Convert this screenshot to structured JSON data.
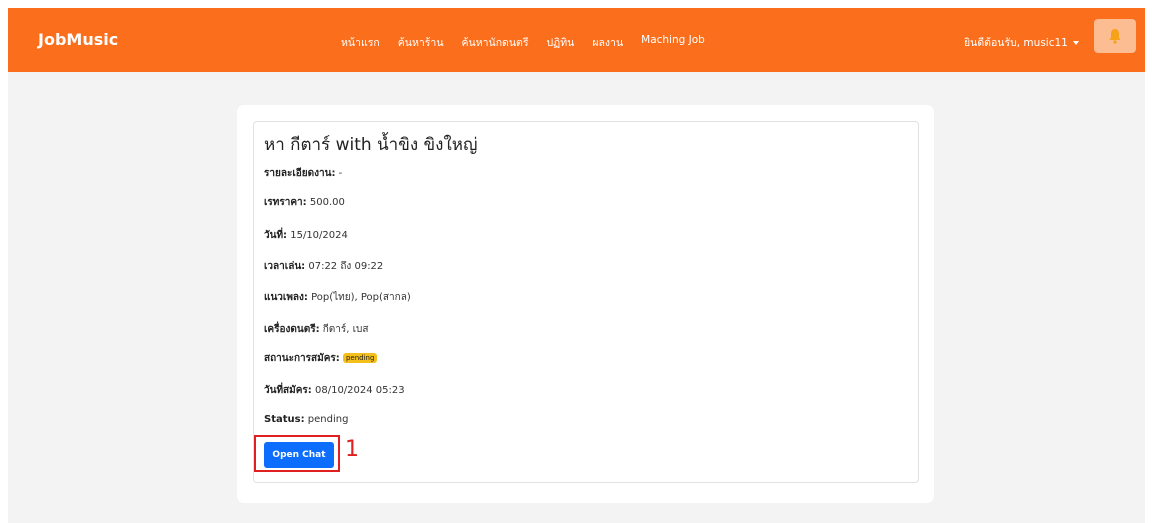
{
  "navbar": {
    "brand": "JobMusic",
    "links": [
      "หน้าแรก",
      "ค้นหาร้าน",
      "ค้นหานักดนตรี",
      "ปฏิทิน",
      "ผลงาน",
      "Maching Job"
    ],
    "user_label": "ยินดีต้อนรับ, music11",
    "bell_icon": "bell-icon",
    "color": "#fb6e1c"
  },
  "job": {
    "title": "หา กีตาร์ with น้ำขิง ขิงใหญ่",
    "rows": [
      {
        "label": "รายละเอียดงาน:",
        "value": " -"
      },
      {
        "label": "เรทราคา:",
        "value": " 500.00"
      },
      {
        "label": "วันที่:",
        "value": " 15/10/2024"
      },
      {
        "label": "เวลาเล่น:",
        "value": " 07:22 ถึง 09:22"
      },
      {
        "label": "แนวเพลง:",
        "value": " Pop(ไทย), Pop(สากล)"
      },
      {
        "label": "เครื่องดนตรี:",
        "value": " กีตาร์, เบส"
      },
      {
        "label": "สถานะการสมัคร:",
        "value": "pending"
      },
      {
        "label": "วันที่สมัคร:",
        "value": " 08/10/2024 05:23"
      },
      {
        "label": "Status:",
        "value": " pending"
      }
    ],
    "open_chat_label": "Open Chat",
    "badge_color": "#f5bf1b"
  },
  "annotation": {
    "marker": "1",
    "color": "#e02020"
  }
}
